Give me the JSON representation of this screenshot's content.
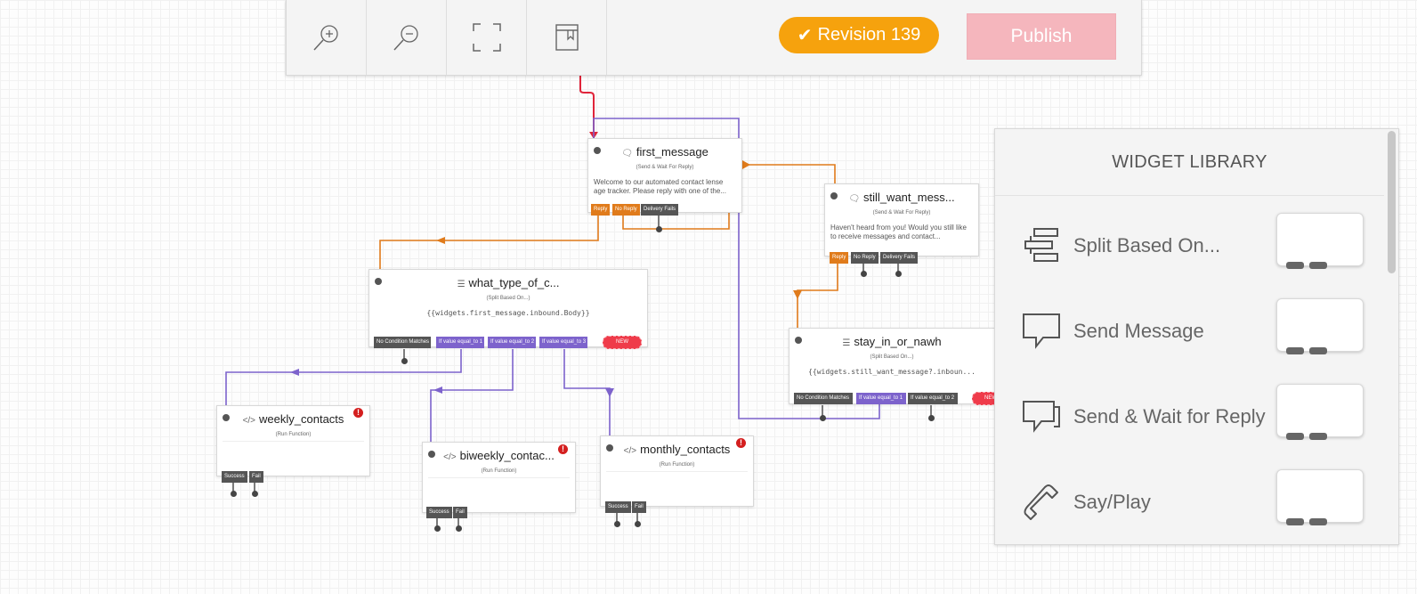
{
  "toolbar": {
    "tools": [
      {
        "icon": "zoom-in-icon"
      },
      {
        "icon": "zoom-out-icon"
      },
      {
        "icon": "fit-screen-icon"
      },
      {
        "icon": "notes-icon"
      }
    ],
    "revision_label": "Revision 139",
    "revision_color": "#f6a20d",
    "publish_label": "Publish",
    "publish_color": "#f5b6bd"
  },
  "canvas": {
    "widgets": {
      "first_message": {
        "title": "first_message",
        "type": "(Send & Wait For Reply)",
        "body": "Welcome to our automated contact lense age tracker. Please reply with one of the...",
        "ports": [
          "Reply",
          "No Reply",
          "Delivery Fails"
        ]
      },
      "still_want_message": {
        "title": "still_want_mess...",
        "type": "(Send & Wait For Reply)",
        "body": "Haven't heard from you! Would you still like to receive messages and contact...",
        "ports": [
          "Reply",
          "No Reply",
          "Delivery Fails"
        ]
      },
      "what_type_of_contact": {
        "title": "what_type_of_c...",
        "type": "(Split Based On...)",
        "body": "{{widgets.first_message.inbound.Body}}",
        "ports": [
          "No Condition Matches",
          "If value equal_to 1",
          "If value equal_to 2",
          "If value equal_to 3",
          "NEW"
        ]
      },
      "stay_in_or_nawh": {
        "title": "stay_in_or_nawh",
        "type": "(Split Based On...)",
        "body": "{{widgets.still_want_message?.inboun...",
        "ports": [
          "No Condition Matches",
          "If value equal_to 1",
          "If value equal_to 2",
          "NEW"
        ]
      },
      "weekly_contacts": {
        "title": "weekly_contacts",
        "type": "(Run Function)",
        "ports": [
          "Success",
          "Fail"
        ]
      },
      "biweekly_contacts": {
        "title": "biweekly_contac...",
        "type": "(Run Function)",
        "ports": [
          "Success",
          "Fail"
        ]
      },
      "monthly_contacts": {
        "title": "monthly_contacts",
        "type": "(Run Function)",
        "ports": [
          "Success",
          "Fail"
        ]
      }
    },
    "wire_colors": {
      "trigger": "#e0243a",
      "reply": "#e07b1b",
      "condition": "#7d63cc"
    }
  },
  "library": {
    "title": "WIDGET LIBRARY",
    "items": [
      {
        "label": "Split Based On...",
        "icon": "split-icon"
      },
      {
        "label": "Send Message",
        "icon": "message-bubble-icon"
      },
      {
        "label": "Send & Wait for Reply",
        "icon": "message-bubbles-icon"
      },
      {
        "label": "Say/Play",
        "icon": "phone-icon"
      }
    ]
  }
}
